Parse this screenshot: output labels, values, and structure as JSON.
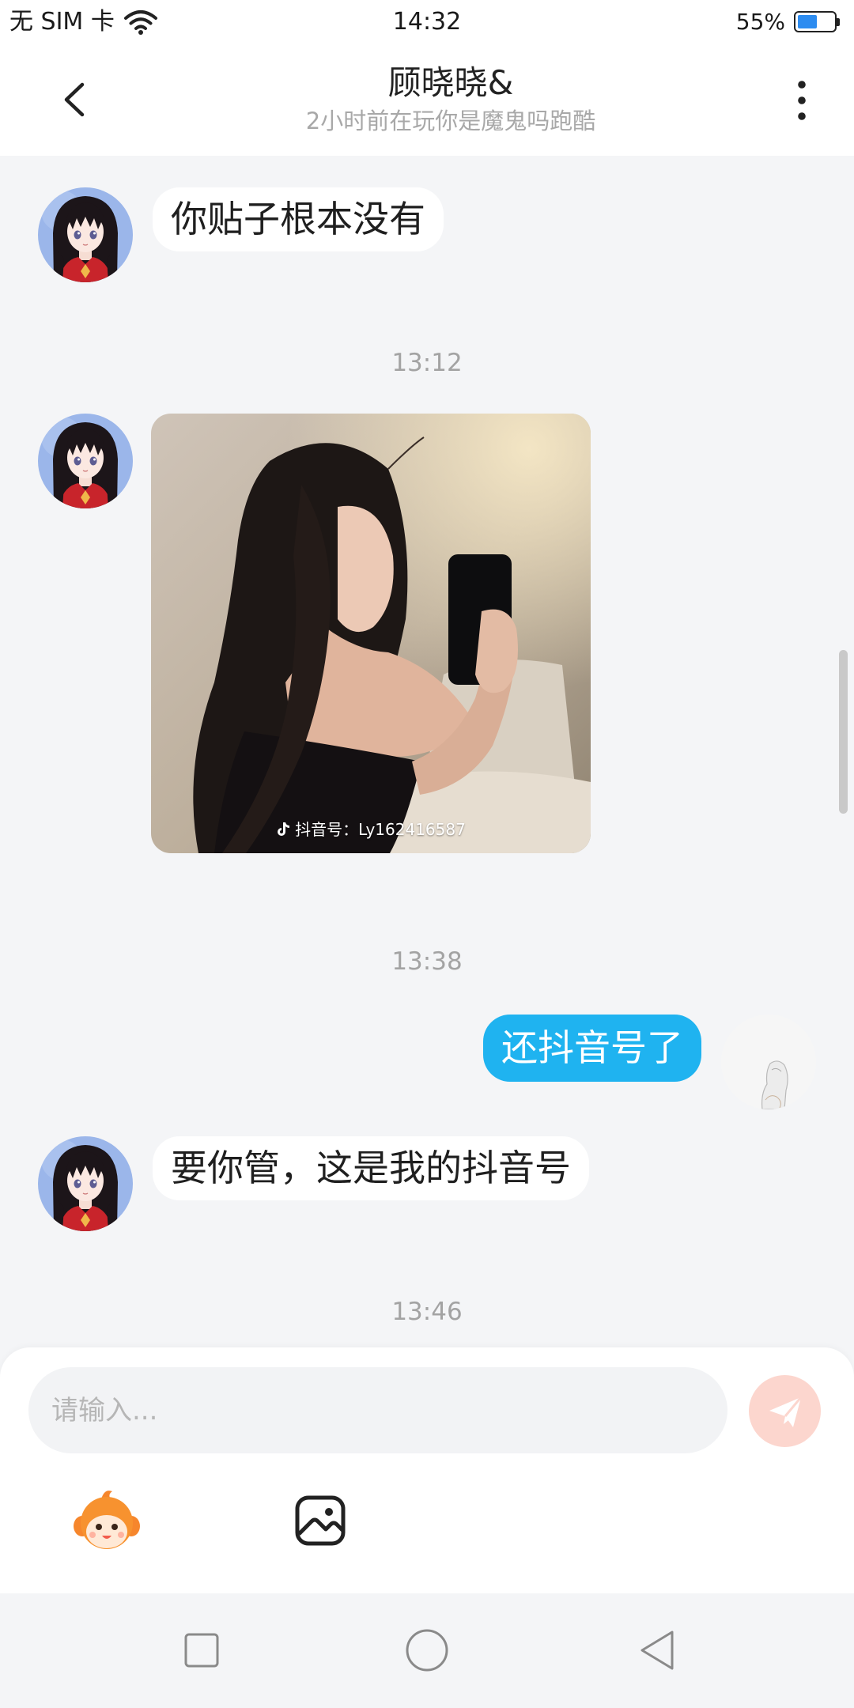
{
  "status_bar": {
    "carrier": "无 SIM 卡",
    "time": "14:32",
    "battery_text": "55%",
    "battery_level": 0.55,
    "icons": [
      "wifi-icon",
      "battery-icon"
    ]
  },
  "header": {
    "title": "顾晓晓&",
    "subtitle": "2小时前在玩你是魔鬼吗跑酷",
    "icons": {
      "back": "chevron-left-icon",
      "menu": "more-vertical-icon"
    }
  },
  "messages": [
    {
      "outgoing": false,
      "text": "你贴子根本没有"
    },
    {
      "timestamp": "13:12"
    },
    {
      "outgoing": false,
      "image": {
        "icon": "douyin-logo-icon",
        "watermark": "抖音号：Ly162416587"
      }
    },
    {
      "timestamp": "13:38"
    },
    {
      "outgoing": true,
      "text": "还抖音号了"
    },
    {
      "outgoing": false,
      "text": "要你管，这是我的抖音号"
    },
    {
      "timestamp": "13:46"
    }
  ],
  "composer": {
    "placeholder": "请输入...",
    "send_icon": "send-icon",
    "tools": [
      "emoji-mascot-icon",
      "image-icon"
    ]
  },
  "nav_bar": {
    "icons": [
      "recent-apps-icon",
      "home-icon",
      "back-icon"
    ]
  },
  "colors": {
    "page_background": "#f4f5f7",
    "bubble_incoming": "#ffffff",
    "bubble_outgoing": "#1fb3f0",
    "send_button": "#fcd6ce",
    "battery_fill": "#2d8cf0",
    "timestamp_text": "#a3a3a3",
    "subtitle_text": "#a8a8a8"
  }
}
